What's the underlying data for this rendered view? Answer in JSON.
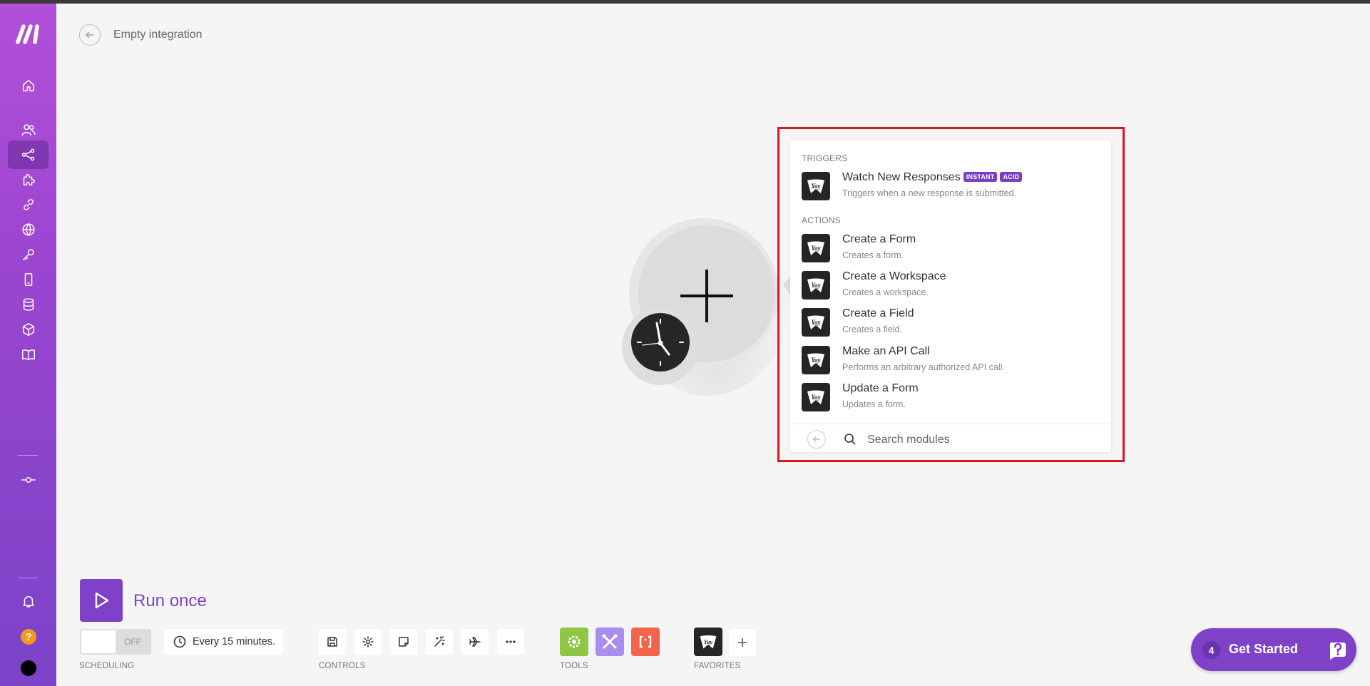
{
  "app": {
    "title": "Empty integration"
  },
  "sidebar": {
    "items": [
      {
        "name": "home"
      },
      {
        "name": "team"
      },
      {
        "name": "scenarios"
      },
      {
        "name": "templates"
      },
      {
        "name": "connections"
      },
      {
        "name": "webhooks"
      },
      {
        "name": "keys"
      },
      {
        "name": "devices"
      },
      {
        "name": "data-stores"
      },
      {
        "name": "data-structures"
      },
      {
        "name": "docs"
      },
      {
        "name": "org-switch"
      }
    ],
    "help_label": "?"
  },
  "module_panel": {
    "triggers_label": "TRIGGERS",
    "actions_label": "ACTIONS",
    "app_icon_text": "Yay",
    "triggers": [
      {
        "title": "Watch New Responses",
        "badges": [
          "INSTANT",
          "ACID"
        ],
        "description": "Triggers when a new response is submitted."
      }
    ],
    "actions": [
      {
        "title": "Create a Form",
        "description": "Creates a form."
      },
      {
        "title": "Create a Workspace",
        "description": "Creates a workspace."
      },
      {
        "title": "Create a Field",
        "description": "Creates a field."
      },
      {
        "title": "Make an API Call",
        "description": "Performs an arbitrary authorized API call."
      },
      {
        "title": "Update a Form",
        "description": "Updates a form."
      }
    ],
    "search": {
      "placeholder": "Search modules",
      "value": ""
    }
  },
  "bottom": {
    "run_label": "Run once",
    "toggle_text": "OFF",
    "schedule_text": "Every 15 minutes.",
    "scheduling_label": "SCHEDULING",
    "controls_label": "CONTROLS",
    "tools_label": "TOOLS",
    "favorites_label": "FAVORITES",
    "tool_colors": {
      "flow": "#8fc643",
      "tools": "#a98ef0",
      "text": "#f2654a"
    }
  },
  "get_started": {
    "count": "4",
    "label": "Get Started"
  },
  "colors": {
    "brand": "#7e41c8",
    "highlight": "#e0141e"
  }
}
